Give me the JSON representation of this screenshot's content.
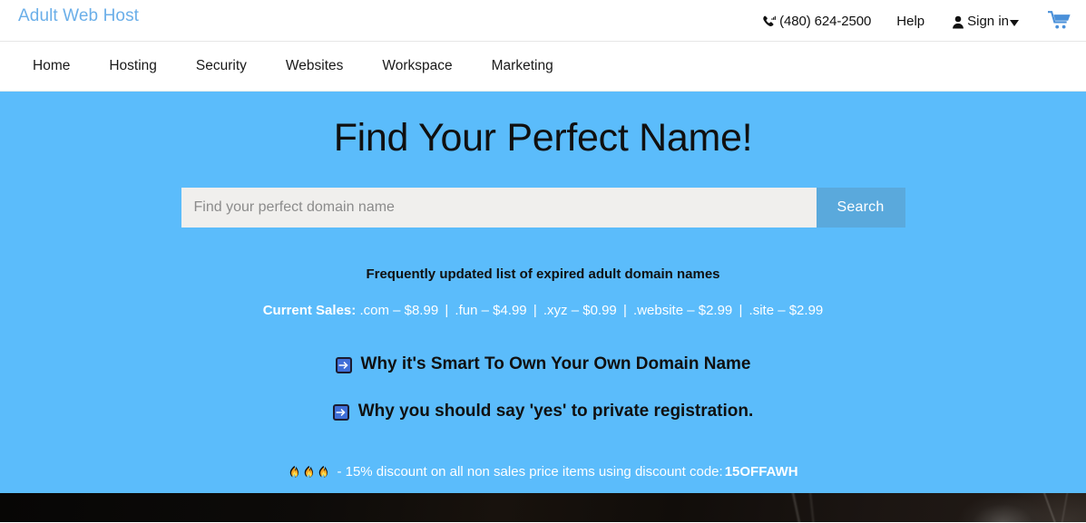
{
  "topbar": {
    "logo": "Adult Web Host",
    "phone_icon": "phone-signal-icon",
    "phone": "(480) 624-2500",
    "help": "Help",
    "person_icon": "person-icon",
    "signin": "Sign in",
    "caret_icon": "chevron-down-icon",
    "cart_icon": "shopping-cart-icon"
  },
  "nav": {
    "items": [
      {
        "label": "Home"
      },
      {
        "label": "Hosting"
      },
      {
        "label": "Security"
      },
      {
        "label": "Websites"
      },
      {
        "label": "Workspace"
      },
      {
        "label": "Marketing"
      }
    ]
  },
  "hero": {
    "title": "Find Your Perfect Name!",
    "search": {
      "value": "",
      "placeholder": "Find your perfect domain name",
      "button_label": "Search"
    },
    "subheading": "Frequently updated list of expired adult domain names",
    "sales": {
      "label": "Current Sales:",
      "items": [
        ".com – $8.99",
        ".fun – $4.99",
        ".xyz – $0.99",
        ".website – $2.99",
        ".site – $2.99"
      ],
      "separator": "|"
    },
    "promos": [
      {
        "icon": "arrow-right-icon",
        "label": "Why it's Smart To Own Your Own Domain Name"
      },
      {
        "icon": "arrow-right-icon",
        "label": "Why you should say 'yes' to private registration."
      }
    ],
    "discount": {
      "fire_icon": "fire-icon",
      "fire_count": 3,
      "text": "- 15% discount on all non sales price items using discount code:",
      "code": "15OFFAWH"
    }
  },
  "bottom_strip": {
    "description": "dark photo banner"
  },
  "colors": {
    "hero_blue": "#5BBCFB",
    "search_button": "#5AA9DC",
    "logo_blue": "#6BAFE9",
    "cart_blue": "#4A90D9",
    "input_bg": "#F0EFED",
    "arrow_box_blue": "#3F6FD8",
    "strip_dark": "#0A0806"
  }
}
